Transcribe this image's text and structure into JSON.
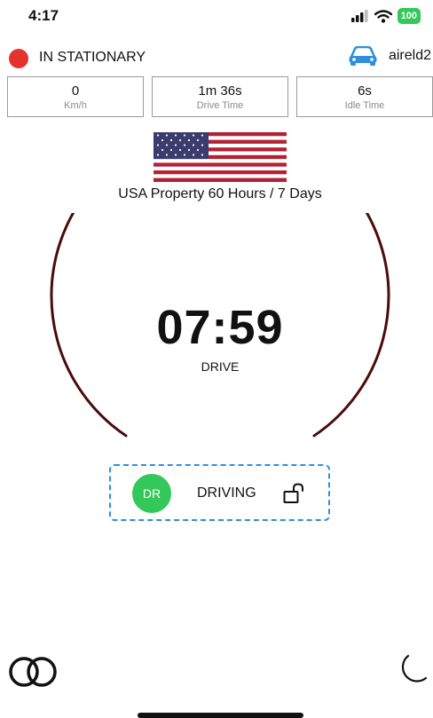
{
  "status_bar": {
    "time": "4:17",
    "battery": "100",
    "icons": [
      "cellular-signal-icon",
      "wifi-icon",
      "battery-icon"
    ],
    "battery_color": "#34c759"
  },
  "header": {
    "status": "IN STATIONARY",
    "status_color": "#e5322d",
    "vehicle_icon": "car-icon",
    "vehicle_color": "#2f8fdf",
    "device": "aireld2"
  },
  "stats": [
    {
      "value": "0",
      "label": "Km/h"
    },
    {
      "value": "1m 36s",
      "label": "Drive Time"
    },
    {
      "value": "6s",
      "label": "Idle Time"
    }
  ],
  "rule": {
    "flag_icon": "us-flag-icon",
    "label": "USA Property 60 Hours / 7 Days"
  },
  "timer": {
    "value": "07:59",
    "label": "DRIVE",
    "ring_color": "#4a0b0b"
  },
  "duty": {
    "abbr": "DR",
    "label": "DRIVING",
    "abbr_color": "#34c759",
    "border_color": "#2f8fdf",
    "lock_icon": "unlock-icon"
  },
  "bottom": {
    "left_icon": "overlapping-circles-icon",
    "right_icon": "moon-icon"
  }
}
